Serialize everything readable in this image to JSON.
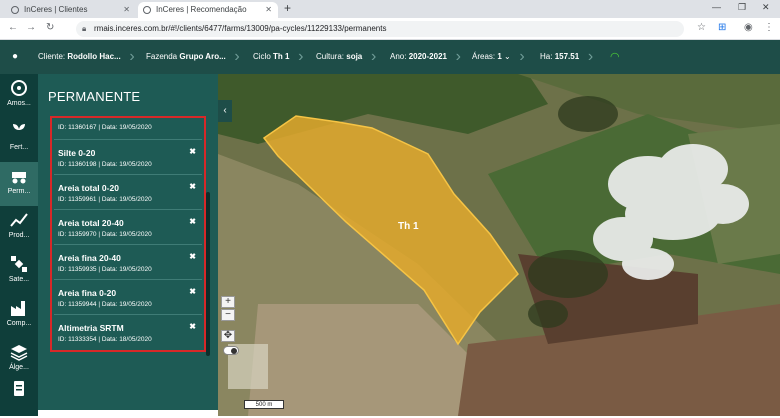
{
  "browser": {
    "tabs": [
      {
        "label": "InCeres | Clientes"
      },
      {
        "label": "InCeres | Recomendação"
      }
    ],
    "url": "rmais.inceres.com.br/#!/clients/6477/farms/13009/pa-cycles/11229133/permanents"
  },
  "appbar": {
    "cliente_label": "Cliente:",
    "cliente_value": "Rodollo Hac...",
    "fazenda_label": "Fazenda",
    "fazenda_value": "Grupo Aro...",
    "ciclo_label": "Ciclo",
    "ciclo_value": "Th 1",
    "cultura_label": "Cultura:",
    "cultura_value": "soja",
    "ano_label": "Ano:",
    "ano_value": "2020-2021",
    "areas_label": "Áreas:",
    "areas_value": "1",
    "ha_label": "Ha:",
    "ha_value": "157.51"
  },
  "nav": [
    {
      "label": "Amos..."
    },
    {
      "label": "Fert..."
    },
    {
      "label": "Perm..."
    },
    {
      "label": "Prod..."
    },
    {
      "label": "Sate..."
    },
    {
      "label": "Comp..."
    },
    {
      "label": "Álge..."
    }
  ],
  "panel": {
    "title": "PERMANENTE",
    "first_meta": "ID: 11360167 | Data: 19/05/2020",
    "items": [
      {
        "title": "Silte 0-20",
        "meta": "ID: 11360198 | Data: 19/05/2020"
      },
      {
        "title": "Areia total 0-20",
        "meta": "ID: 11359961 | Data: 19/05/2020"
      },
      {
        "title": "Areia total 20-40",
        "meta": "ID: 11359970 | Data: 19/05/2020"
      },
      {
        "title": "Areia fina 20-40",
        "meta": "ID: 11359935 | Data: 19/05/2020"
      },
      {
        "title": "Areia fina 0-20",
        "meta": "ID: 11359944 | Data: 19/05/2020"
      },
      {
        "title": "Altimetria SRTM",
        "meta": "ID: 11333354 | Data: 18/05/2020"
      }
    ]
  },
  "map": {
    "field_label": "Th 1",
    "scale_label": "500 m",
    "field_color": "#e3a92d"
  }
}
